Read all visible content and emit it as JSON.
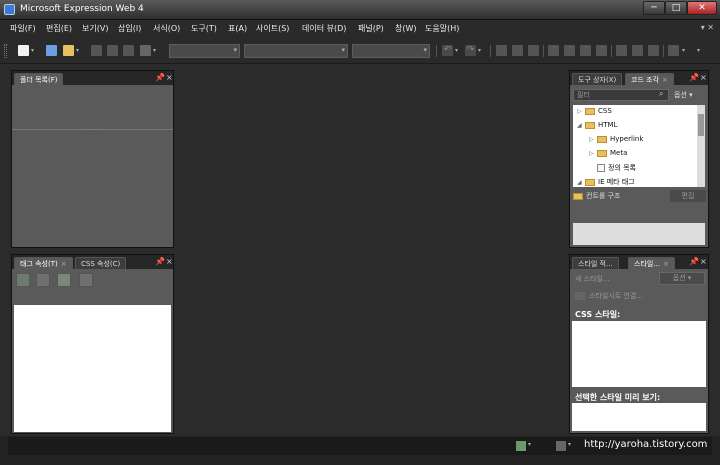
{
  "window": {
    "title": "Microsoft Expression Web 4",
    "min": "─",
    "max": "□",
    "close": "✕"
  },
  "menu": {
    "items": [
      "파일(F)",
      "편집(E)",
      "보기(V)",
      "삽입(I)",
      "서식(O)",
      "도구(T)",
      "표(A)",
      "사이트(S)",
      "데이터 뷰(D)",
      "패널(P)",
      "창(W)",
      "도움말(H)"
    ],
    "help_ctrl": "▾ ✕"
  },
  "toolbar": {
    "icons": [
      "new-page-icon",
      "open-icon",
      "save-icon",
      "publish-icon",
      "preview-icon",
      "undo-icon",
      "redo-icon",
      "bold-icon",
      "italic-icon",
      "underline-icon",
      "align-left-icon",
      "align-center-icon",
      "align-right-icon",
      "justify-icon",
      "numbered-list-icon",
      "bulleted-list-icon",
      "outdent-icon",
      "indent-icon",
      "borders-icon"
    ],
    "accent": "#3a7bd5"
  },
  "folder_panel": {
    "tab": "폴더 목록(F)",
    "pin": "📌",
    "close": "×"
  },
  "tag_panel": {
    "tab1": "태그 속성(T)",
    "tab1_close": "×",
    "tab2": "CSS 속성(C)",
    "pin": "📌",
    "close": "×"
  },
  "toolbox_panel": {
    "tab1": "도구 상자(X)",
    "tab2": "코드 조각",
    "tab2_close": "×",
    "filter_placeholder": "필터",
    "options": "옵션 ▾",
    "tree": [
      {
        "label": "CSS",
        "indent": 0,
        "expanded": false
      },
      {
        "label": "HTML",
        "indent": 0,
        "expanded": true
      },
      {
        "label": "Hyperlink",
        "indent": 1,
        "expanded": false
      },
      {
        "label": "Meta",
        "indent": 1,
        "expanded": false
      },
      {
        "label": "정의 목록",
        "indent": 1,
        "expanded": false
      },
      {
        "label": "IE 메타 태그",
        "indent": 0,
        "expanded": true
      }
    ],
    "footer_folder": "컨트롤 구조",
    "footer_btn": "편집"
  },
  "style_panel": {
    "tab1": "스타일 적...",
    "tab2": "스타일...",
    "tab2_close": "×",
    "new_style": "새 스타일...",
    "options": "옵션 ▾",
    "attach_stylesheet": "스타일시트 연결...",
    "css_styles_label": "CSS 스타일:",
    "preview_label": "선택한 스타일 미리 보기:"
  },
  "status": {
    "url": "http://yaroha.tistory.com"
  }
}
